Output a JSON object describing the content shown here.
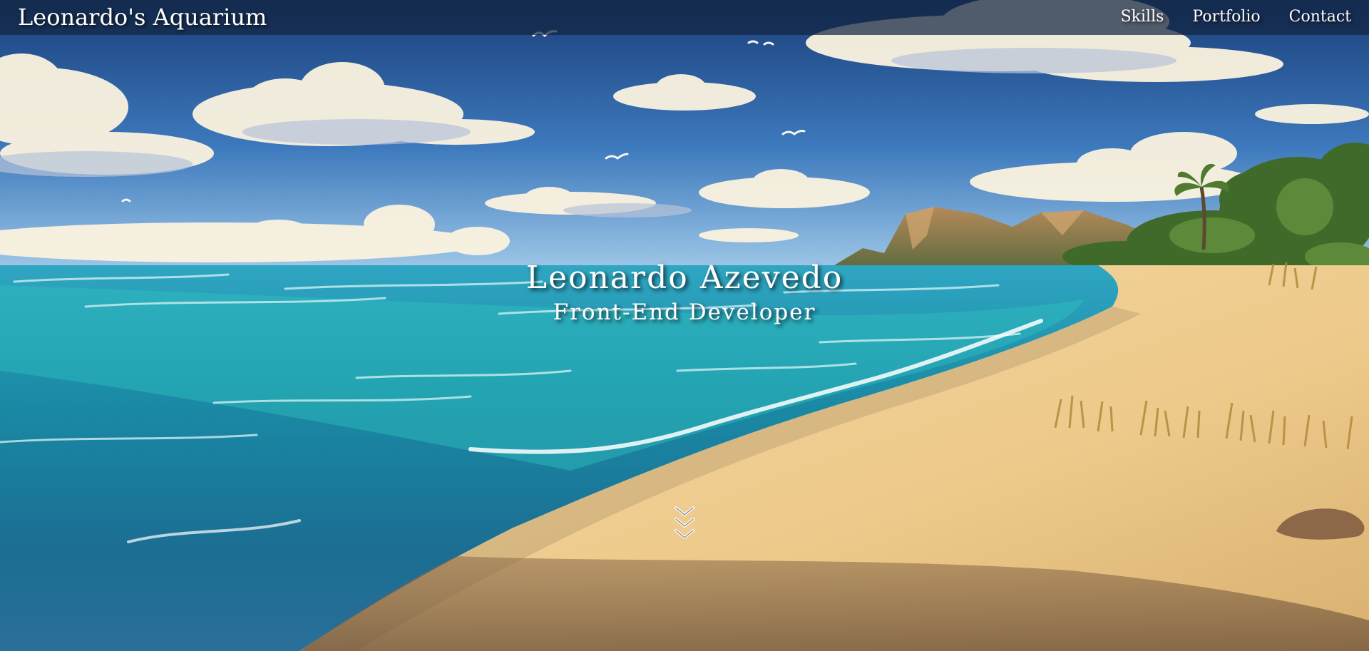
{
  "navbar": {
    "brand": "Leonardo's Aquarium",
    "links": [
      "Skills",
      "Portfolio",
      "Contact"
    ]
  },
  "hero": {
    "name": "Leonardo Azevedo",
    "role": "Front-End Developer",
    "scroll_icon": "triple-chevron-down-icon",
    "background": "beach-painting"
  },
  "colors": {
    "sky_top": "#1f4a8a",
    "sky_horizon": "#7fb3de",
    "ocean": "#1a8fa8",
    "shallow": "#2fc4c0",
    "sand": "#f2d39a",
    "navbar": "#122440"
  }
}
